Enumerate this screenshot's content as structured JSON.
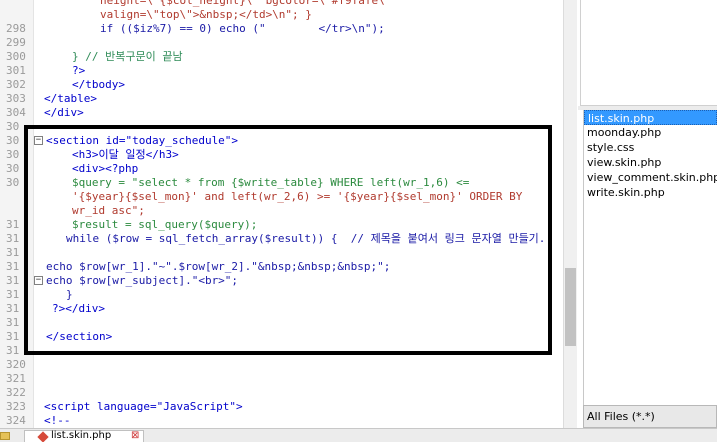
{
  "editor": {
    "lines": [
      {
        "num": "",
        "fold": "",
        "indent": 100,
        "text": "height=\\\"{$col_height}\\\" bgcolor=\\\"#f9fafe\\\"",
        "kind": "str"
      },
      {
        "num": "",
        "fold": "",
        "indent": 100,
        "text": "valign=\\\"top\\\">&nbsp;</td>\\n\"; }",
        "kind": "str"
      },
      {
        "num": "298",
        "fold": "",
        "indent": 100,
        "text": "if (($iz%7) == 0) echo (\"        </tr>\\n\");",
        "kind": "code"
      },
      {
        "num": "299",
        "fold": "",
        "indent": 0,
        "text": "",
        "kind": "code"
      },
      {
        "num": "300",
        "fold": "",
        "indent": 72,
        "text": "} // 반복구문이 끝남",
        "kind": "cmt"
      },
      {
        "num": "301",
        "fold": "",
        "indent": 72,
        "text": "?>",
        "kind": "tag"
      },
      {
        "num": "302",
        "fold": "",
        "indent": 72,
        "text": "</tbody>",
        "kind": "tag"
      },
      {
        "num": "303",
        "fold": "",
        "indent": 44,
        "text": "</table>",
        "kind": "tag"
      },
      {
        "num": "304",
        "fold": "",
        "indent": 44,
        "text": "</div>",
        "kind": "tag"
      },
      {
        "num": "30",
        "fold": "",
        "indent": 0,
        "text": "",
        "kind": "code"
      },
      {
        "num": "30",
        "fold": "⊟",
        "indent": 46,
        "text": "<section id=\"today_schedule\">",
        "kind": "tag"
      },
      {
        "num": "30",
        "fold": "",
        "indent": 72,
        "text": "<h3>이달 일정</h3>",
        "kind": "tag"
      },
      {
        "num": "30",
        "fold": "",
        "indent": 72,
        "text": "<div><?php",
        "kind": "tag"
      },
      {
        "num": "30",
        "fold": "",
        "indent": 72,
        "text": "$query = \"select * from {$write_table} WHERE left(wr_1,6) <=",
        "kind": "var"
      },
      {
        "num": "",
        "fold": "",
        "indent": 72,
        "text": "'{$year}{$sel_mon}' and left(wr_2,6) >= '{$year}{$sel_mon}' ORDER BY",
        "kind": "str"
      },
      {
        "num": "",
        "fold": "",
        "indent": 72,
        "text": "wr_id asc\";",
        "kind": "str"
      },
      {
        "num": "31",
        "fold": "",
        "indent": 72,
        "text": "$result = sql_query($query);",
        "kind": "var"
      },
      {
        "num": "31",
        "fold": "",
        "indent": 66,
        "text": "while ($row = sql_fetch_array($result)) {  // 제목을 붙여서 링크 문자열 만들기..",
        "kind": "code"
      },
      {
        "num": "31",
        "fold": "",
        "indent": 0,
        "text": "",
        "kind": "code"
      },
      {
        "num": "31",
        "fold": "",
        "indent": 46,
        "text": "echo $row[wr_1].\"~\".$row[wr_2].\"&nbsp;&nbsp;&nbsp;\";",
        "kind": "code"
      },
      {
        "num": "31",
        "fold": "⊟",
        "indent": 46,
        "text": "echo $row[wr_subject].\"<br>\";",
        "kind": "code"
      },
      {
        "num": "31",
        "fold": "",
        "indent": 66,
        "text": "}",
        "kind": "code"
      },
      {
        "num": "31",
        "fold": "",
        "indent": 52,
        "text": "?></div>",
        "kind": "tag"
      },
      {
        "num": "31",
        "fold": "",
        "indent": 0,
        "text": "",
        "kind": "code"
      },
      {
        "num": "31",
        "fold": "",
        "indent": 46,
        "text": "</section>",
        "kind": "tag"
      },
      {
        "num": "31",
        "fold": "",
        "indent": 0,
        "text": "",
        "kind": "code"
      },
      {
        "num": "320",
        "fold": "",
        "indent": 0,
        "text": "",
        "kind": "code"
      },
      {
        "num": "321",
        "fold": "",
        "indent": 0,
        "text": "",
        "kind": "code"
      },
      {
        "num": "322",
        "fold": "",
        "indent": 0,
        "text": "",
        "kind": "code"
      },
      {
        "num": "323",
        "fold": "",
        "indent": 44,
        "text": "<script language=\"JavaScript\">",
        "kind": "tag"
      },
      {
        "num": "324",
        "fold": "",
        "indent": 44,
        "text": "<!--",
        "kind": "tag"
      }
    ]
  },
  "files": {
    "items": [
      "list.skin.php",
      "moonday.php",
      "style.css",
      "view.skin.php",
      "view_comment.skin.php",
      "write.skin.php"
    ],
    "selected": 0,
    "filter": "All Files (*.*)"
  },
  "tabs": {
    "active_label": "list.skin.php",
    "close_glyph": "⊠"
  },
  "colors": {
    "highlight_border": "#000000",
    "selection": "#3399ff"
  }
}
